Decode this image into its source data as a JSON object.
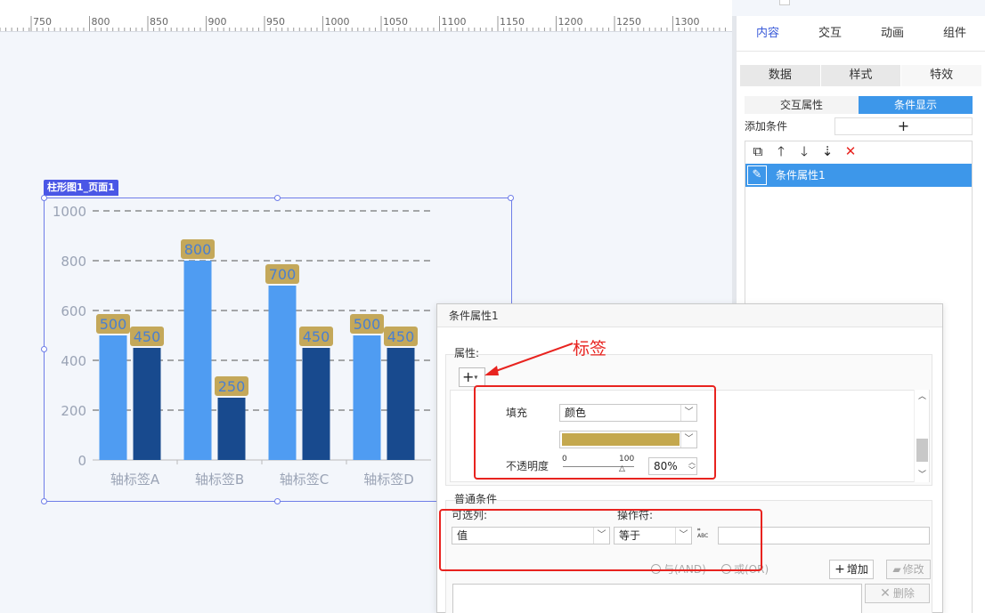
{
  "ruler": {
    "labels": [
      "750",
      "800",
      "850",
      "900",
      "950",
      "1000",
      "1050",
      "1100",
      "1150",
      "1200",
      "1250",
      "1300"
    ]
  },
  "widget": {
    "tag": "柱形图1_页面1"
  },
  "chart_data": {
    "type": "bar",
    "categories": [
      "轴标签A",
      "轴标签B",
      "轴标签C",
      "轴标签D"
    ],
    "series": [
      {
        "values": [
          500,
          800,
          700,
          500
        ],
        "color": "#4f9cf2"
      },
      {
        "values": [
          450,
          250,
          450,
          450
        ],
        "color": "#184a8e"
      }
    ],
    "yticks": [
      "0",
      "200",
      "400",
      "600",
      "800",
      "1000"
    ],
    "ylim": [
      0,
      1000
    ],
    "grid": "dashed-horizontal",
    "label_bg": "#c4a85a",
    "label_color": "#4a7fd0"
  },
  "panel": {
    "tabs": [
      "内容",
      "交互",
      "动画",
      "组件"
    ],
    "active_tab": "内容",
    "subtabs": [
      "数据",
      "样式",
      "特效"
    ],
    "ctabs": [
      "交互属性",
      "条件显示"
    ],
    "add_condition_label": "添加条件",
    "add_condition_btn": "+",
    "toolbar_icons": [
      "copy-icon",
      "arrow-up-icon",
      "arrow-down-icon",
      "sort-icon",
      "delete-icon"
    ],
    "toolbar_glyphs": [
      "⧉",
      "🡑",
      "🡓",
      "⇣",
      "✕"
    ],
    "list_item": "条件属性1",
    "pen_glyph": "✎"
  },
  "dialog": {
    "title": "条件属性1",
    "attr_label": "属性:",
    "plus_glyph": "+",
    "fill_label": "填充",
    "fill_type": "颜色",
    "fill_color": "#c4a84e",
    "opacity_label": "不透明度",
    "slider_min": "0",
    "slider_max": "100",
    "opacity_value": "80%",
    "general_label": "普通条件",
    "column_label": "可选列:",
    "operator_label": "操作符:",
    "column_value": "值",
    "operator_value": "等于",
    "and_label": "与(AND)",
    "or_label": "或(OR)",
    "add_btn": "增加",
    "modify_btn": "修改",
    "delete_btn": "删除",
    "plus": "+",
    "cross": "✕",
    "abc": "ABC"
  },
  "annotation": {
    "text": "标签",
    "color": "#e8231f"
  }
}
